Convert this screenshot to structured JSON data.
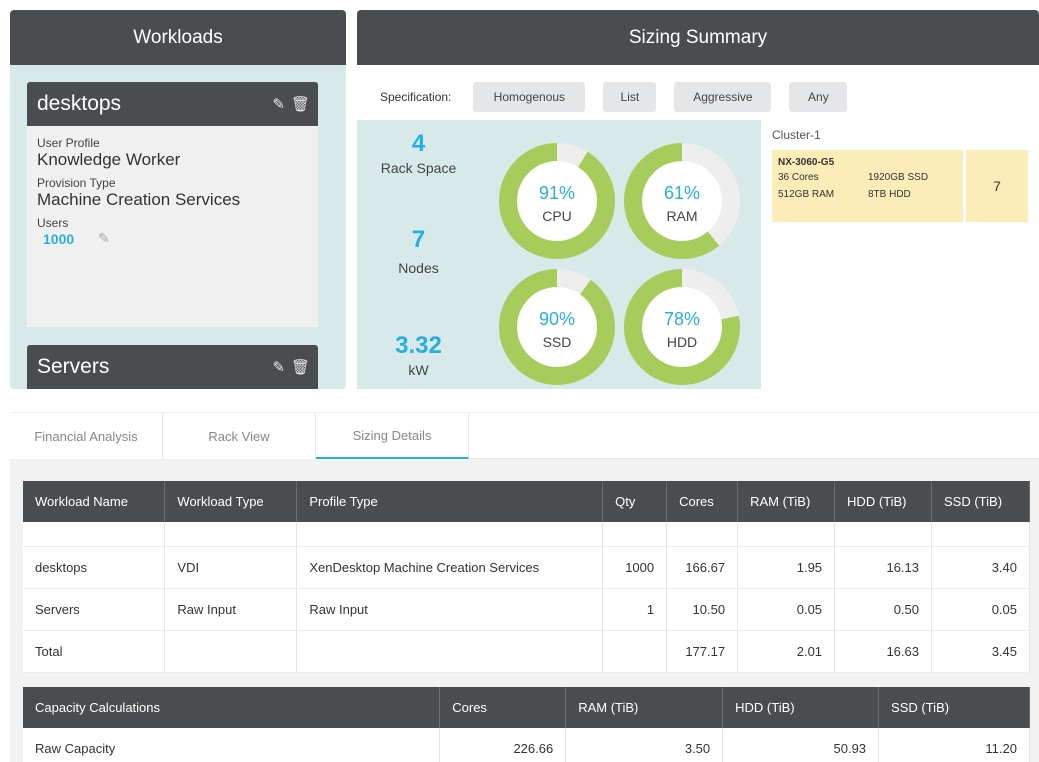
{
  "workloads": {
    "title": "Workloads",
    "cards": [
      {
        "name": "desktops",
        "fields": [
          {
            "label": "User Profile",
            "value": "Knowledge Worker"
          },
          {
            "label": "Provision Type",
            "value": "Machine Creation Services"
          }
        ],
        "users_label": "Users",
        "users_value": "1000"
      },
      {
        "name": "Servers"
      }
    ]
  },
  "sizing": {
    "title": "Sizing Summary",
    "spec_label": "Specification:",
    "spec_buttons": [
      "Homogenous",
      "List",
      "Aggressive",
      "Any"
    ],
    "metrics": [
      {
        "value": "4",
        "label": "Rack Space"
      },
      {
        "value": "7",
        "label": "Nodes"
      },
      {
        "value": "3.32",
        "label": "kW"
      }
    ],
    "gauges": [
      {
        "percent": 91,
        "label": "CPU"
      },
      {
        "percent": 61,
        "label": "RAM"
      },
      {
        "percent": 90,
        "label": "SSD"
      },
      {
        "percent": 78,
        "label": "HDD"
      }
    ],
    "cluster": {
      "name": "Cluster-1",
      "node_model": "NX-3060-G5",
      "cores": "36 Cores",
      "ssd": "1920GB SSD",
      "ram": "512GB RAM",
      "hdd": "8TB HDD",
      "count": "7"
    }
  },
  "tabs": [
    "Financial Analysis",
    "Rack View",
    "Sizing Details"
  ],
  "workload_table": {
    "headers": [
      "Workload Name",
      "Workload Type",
      "Profile Type",
      "Qty",
      "Cores",
      "RAM (TiB)",
      "HDD (TiB)",
      "SSD (TiB)"
    ],
    "rows": [
      [
        "desktops",
        "VDI",
        "XenDesktop Machine Creation Services",
        "1000",
        "166.67",
        "1.95",
        "16.13",
        "3.40"
      ],
      [
        "Servers",
        "Raw Input",
        "Raw Input",
        "1",
        "10.50",
        "0.05",
        "0.50",
        "0.05"
      ],
      [
        "Total",
        "",
        "",
        "",
        "177.17",
        "2.01",
        "16.63",
        "3.45"
      ]
    ]
  },
  "capacity_table": {
    "headers": [
      "Capacity Calculations",
      "Cores",
      "RAM (TiB)",
      "HDD (TiB)",
      "SSD (TiB)"
    ],
    "rows": [
      [
        "Raw Capacity",
        "226.66",
        "3.50",
        "50.93",
        "11.20"
      ]
    ]
  },
  "colors": {
    "header_dark": "#4a4d4f",
    "panel_teal": "#d7e9e9",
    "accent_blue": "#29aee2",
    "gauge_green": "#a6cc5c",
    "node_yellow": "#fcedb8"
  }
}
